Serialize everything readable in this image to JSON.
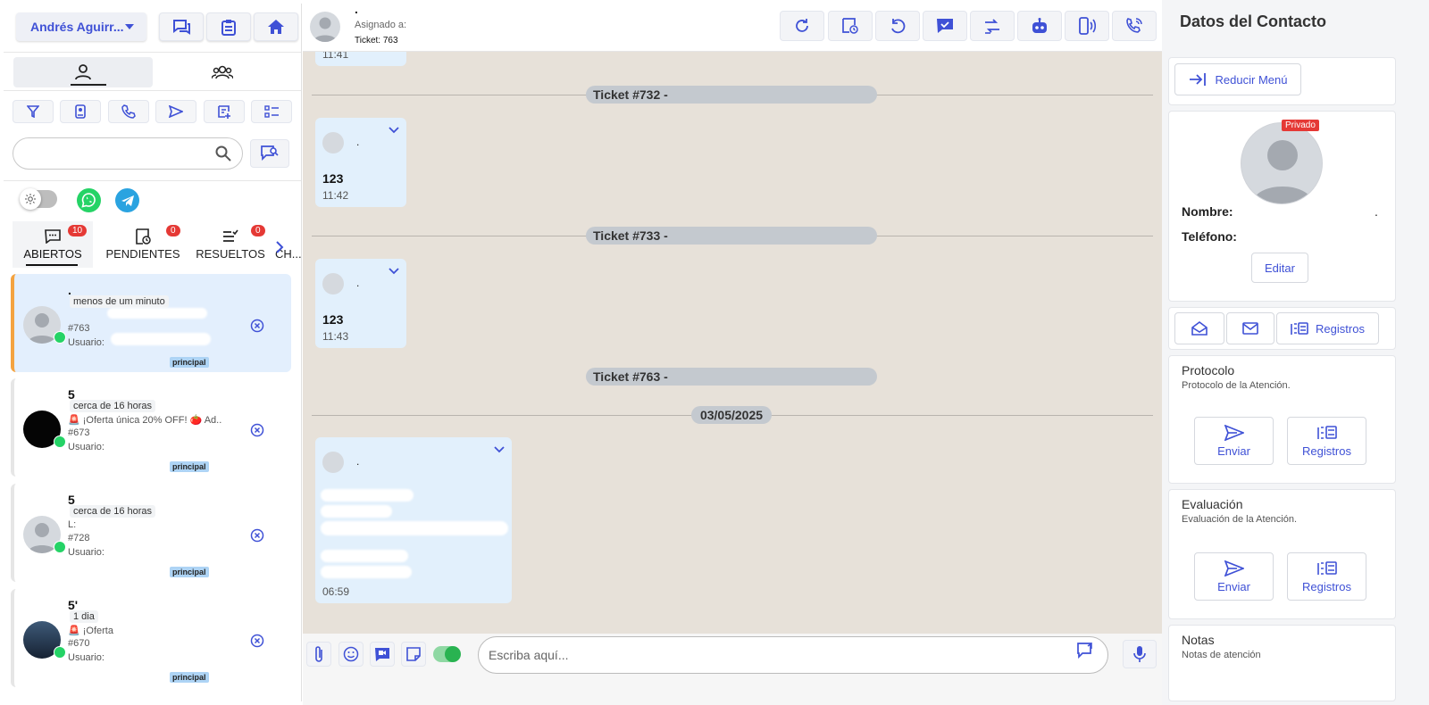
{
  "header": {
    "user_name": "Andrés Aguirr...",
    "contact_name": ".",
    "assigned_label": "Asignado a:",
    "ticket_label": "Ticket: 763"
  },
  "left": {
    "search_placeholder": "",
    "tabs": [
      {
        "label": "ABIERTOS",
        "count": "10"
      },
      {
        "label": "PENDIENTES",
        "count": "0"
      },
      {
        "label": "RESUELTOS",
        "count": "0"
      },
      {
        "label": "CH..."
      }
    ]
  },
  "tickets": [
    {
      "name": ".",
      "time": "menos de um minuto",
      "preview": "",
      "id": "#763",
      "user": "Usuario:",
      "queue": "principal"
    },
    {
      "name": "5",
      "time": "cerca de 16 horas",
      "preview": "🚨 ¡Oferta única 20% OFF! 🍅 Ad...",
      "id": "#673",
      "user": "Usuario:",
      "queue": "principal"
    },
    {
      "name": "5",
      "time": "cerca de 16 horas",
      "preview": "L:",
      "id": "#728",
      "user": "Usuario:",
      "queue": "principal"
    },
    {
      "name": "5'",
      "time": "1 dia",
      "preview": "🚨 ¡Oferta",
      "id": "#670",
      "user": "Usuario:",
      "queue": "principal"
    }
  ],
  "chat": {
    "ticket_separators": [
      "Ticket #732 -",
      "Ticket #733 -",
      "Ticket #763 -"
    ],
    "date_separator": "03/05/2025",
    "messages": [
      {
        "sender": ".",
        "text": "",
        "time": "11:41"
      },
      {
        "sender": ".",
        "text": "123",
        "time": "11:42"
      },
      {
        "sender": ".",
        "text": "123",
        "time": "11:43"
      },
      {
        "sender": ".",
        "text": "",
        "time": "06:59"
      }
    ],
    "input_placeholder": "Escriba aquí..."
  },
  "contact": {
    "title": "Datos del Contacto",
    "collapse_label": "Reducir Menú",
    "private_badge": "Privado",
    "name_label": "Nombre:",
    "name_value": ".",
    "phone_label": "Teléfono:",
    "phone_value": "",
    "edit_label": "Editar",
    "registros_label": "Registros",
    "protocol": {
      "title": "Protocolo",
      "subtitle": "Protocolo de la Atención.",
      "send": "Enviar",
      "logs": "Registros"
    },
    "evaluation": {
      "title": "Evaluación",
      "subtitle": "Evaluación de la Atención.",
      "send": "Enviar",
      "logs": "Registros"
    },
    "notes": {
      "title": "Notas",
      "subtitle": "Notas de atención"
    }
  }
}
